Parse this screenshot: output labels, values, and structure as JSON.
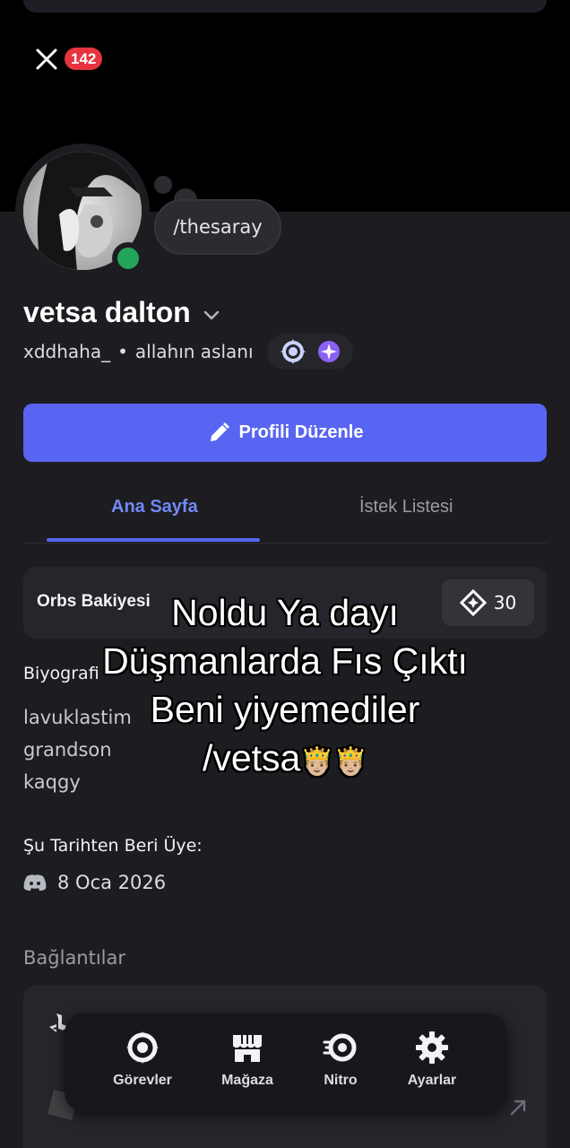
{
  "header": {
    "notification_count": "142"
  },
  "profile": {
    "custom_status": "/thesaray",
    "display_name": "vetsa dalton",
    "username": "xddhaha_",
    "pronouns": "allahın aslanı",
    "edit_button_label": "Profili Düzenle"
  },
  "tabs": [
    {
      "label": "Ana Sayfa",
      "active": true
    },
    {
      "label": "İstek Listesi",
      "active": false
    }
  ],
  "orbs": {
    "label": "Orbs Bakiyesi",
    "balance": "30"
  },
  "bio": {
    "label": "Biyografi",
    "lines": [
      "lavuklastim",
      "grandson",
      "kaqgy"
    ]
  },
  "member_since": {
    "label": "Şu Tarihten Beri Üye:",
    "date": "8 Oca 2026"
  },
  "connections": {
    "label": "Bağlantılar"
  },
  "bottom_nav": [
    {
      "label": "Görevler",
      "icon": "quests-icon"
    },
    {
      "label": "Mağaza",
      "icon": "shop-icon"
    },
    {
      "label": "Nitro",
      "icon": "nitro-icon"
    },
    {
      "label": "Ayarlar",
      "icon": "gear-icon"
    }
  ],
  "overlay_caption": {
    "lines": [
      "Noldu Ya dayı",
      "Düşmanlarda Fıs Çıktı",
      "Beni yiyemediler",
      "/vetsa"
    ],
    "emoji": "🤴🏼🤴🏼"
  },
  "colors": {
    "accent": "#5865f2",
    "online": "#23a55a",
    "badge": "#e5343f",
    "background": "#1c1c21"
  }
}
